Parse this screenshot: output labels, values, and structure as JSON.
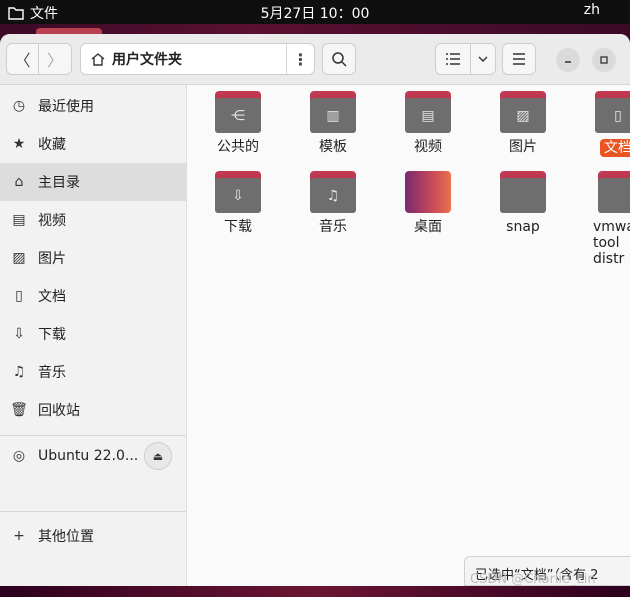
{
  "topbar": {
    "app_name": "文件",
    "clock": "5月27日  10：00",
    "lang": "zh"
  },
  "header": {
    "path_label": "用户文件夹",
    "more_label": "⋮"
  },
  "sidebar": {
    "items": [
      {
        "label": "最近使用",
        "icon": "clock-icon"
      },
      {
        "label": "收藏",
        "icon": "star-icon"
      },
      {
        "label": "主目录",
        "icon": "home-icon"
      },
      {
        "label": "视频",
        "icon": "video-icon"
      },
      {
        "label": "图片",
        "icon": "image-icon"
      },
      {
        "label": "文档",
        "icon": "document-icon"
      },
      {
        "label": "下载",
        "icon": "download-icon"
      },
      {
        "label": "音乐",
        "icon": "music-icon"
      },
      {
        "label": "回收站",
        "icon": "trash-icon"
      }
    ],
    "device": {
      "label": "Ubuntu 22.0..."
    },
    "other": {
      "label": "其他位置"
    }
  },
  "files": [
    {
      "name": "公共的",
      "icon": "share-icon"
    },
    {
      "name": "模板",
      "icon": "template-icon"
    },
    {
      "name": "视频",
      "icon": "video-icon"
    },
    {
      "name": "图片",
      "icon": "image-icon"
    },
    {
      "name": "文档",
      "icon": "document-icon",
      "selected": true
    },
    {
      "name": "下载",
      "icon": "download-icon"
    },
    {
      "name": "音乐",
      "icon": "music-icon"
    },
    {
      "name": "桌面",
      "icon": "desktop-icon"
    },
    {
      "name": "snap",
      "icon": "folder-icon"
    },
    {
      "name": "vmwa\ntool\ndistr",
      "icon": "folder-icon"
    }
  ],
  "status": {
    "text": "已选中“文档”（含有 2"
  },
  "watermark": "CSDN @Charlie_Lin",
  "colors": {
    "accent": "#e95420",
    "folder_tab": "#b5304c",
    "folder_body": "#6e6e6e"
  }
}
